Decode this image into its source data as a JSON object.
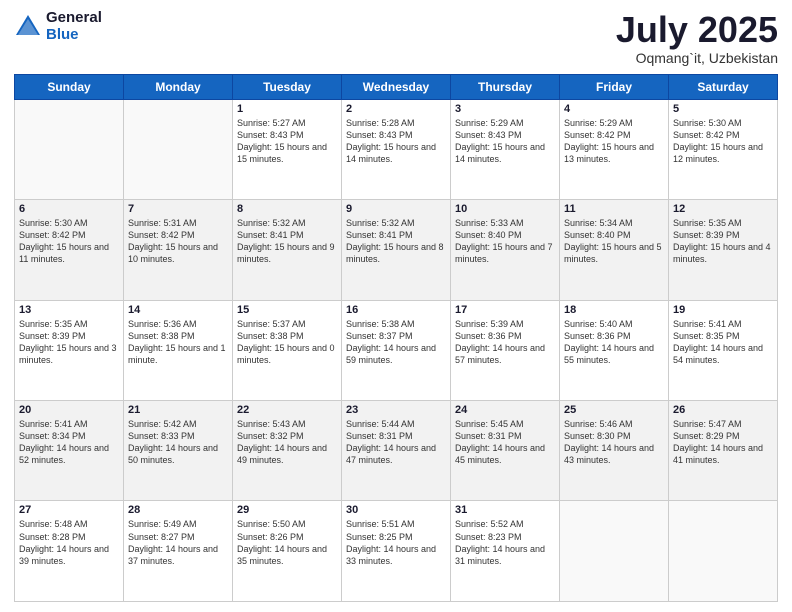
{
  "logo": {
    "general": "General",
    "blue": "Blue"
  },
  "title": {
    "month": "July 2025",
    "location": "Oqmang`it, Uzbekistan"
  },
  "weekdays": [
    "Sunday",
    "Monday",
    "Tuesday",
    "Wednesday",
    "Thursday",
    "Friday",
    "Saturday"
  ],
  "weeks": [
    [
      {
        "day": "",
        "sunrise": "",
        "sunset": "",
        "daylight": ""
      },
      {
        "day": "",
        "sunrise": "",
        "sunset": "",
        "daylight": ""
      },
      {
        "day": "1",
        "sunrise": "Sunrise: 5:27 AM",
        "sunset": "Sunset: 8:43 PM",
        "daylight": "Daylight: 15 hours and 15 minutes."
      },
      {
        "day": "2",
        "sunrise": "Sunrise: 5:28 AM",
        "sunset": "Sunset: 8:43 PM",
        "daylight": "Daylight: 15 hours and 14 minutes."
      },
      {
        "day": "3",
        "sunrise": "Sunrise: 5:29 AM",
        "sunset": "Sunset: 8:43 PM",
        "daylight": "Daylight: 15 hours and 14 minutes."
      },
      {
        "day": "4",
        "sunrise": "Sunrise: 5:29 AM",
        "sunset": "Sunset: 8:42 PM",
        "daylight": "Daylight: 15 hours and 13 minutes."
      },
      {
        "day": "5",
        "sunrise": "Sunrise: 5:30 AM",
        "sunset": "Sunset: 8:42 PM",
        "daylight": "Daylight: 15 hours and 12 minutes."
      }
    ],
    [
      {
        "day": "6",
        "sunrise": "Sunrise: 5:30 AM",
        "sunset": "Sunset: 8:42 PM",
        "daylight": "Daylight: 15 hours and 11 minutes."
      },
      {
        "day": "7",
        "sunrise": "Sunrise: 5:31 AM",
        "sunset": "Sunset: 8:42 PM",
        "daylight": "Daylight: 15 hours and 10 minutes."
      },
      {
        "day": "8",
        "sunrise": "Sunrise: 5:32 AM",
        "sunset": "Sunset: 8:41 PM",
        "daylight": "Daylight: 15 hours and 9 minutes."
      },
      {
        "day": "9",
        "sunrise": "Sunrise: 5:32 AM",
        "sunset": "Sunset: 8:41 PM",
        "daylight": "Daylight: 15 hours and 8 minutes."
      },
      {
        "day": "10",
        "sunrise": "Sunrise: 5:33 AM",
        "sunset": "Sunset: 8:40 PM",
        "daylight": "Daylight: 15 hours and 7 minutes."
      },
      {
        "day": "11",
        "sunrise": "Sunrise: 5:34 AM",
        "sunset": "Sunset: 8:40 PM",
        "daylight": "Daylight: 15 hours and 5 minutes."
      },
      {
        "day": "12",
        "sunrise": "Sunrise: 5:35 AM",
        "sunset": "Sunset: 8:39 PM",
        "daylight": "Daylight: 15 hours and 4 minutes."
      }
    ],
    [
      {
        "day": "13",
        "sunrise": "Sunrise: 5:35 AM",
        "sunset": "Sunset: 8:39 PM",
        "daylight": "Daylight: 15 hours and 3 minutes."
      },
      {
        "day": "14",
        "sunrise": "Sunrise: 5:36 AM",
        "sunset": "Sunset: 8:38 PM",
        "daylight": "Daylight: 15 hours and 1 minute."
      },
      {
        "day": "15",
        "sunrise": "Sunrise: 5:37 AM",
        "sunset": "Sunset: 8:38 PM",
        "daylight": "Daylight: 15 hours and 0 minutes."
      },
      {
        "day": "16",
        "sunrise": "Sunrise: 5:38 AM",
        "sunset": "Sunset: 8:37 PM",
        "daylight": "Daylight: 14 hours and 59 minutes."
      },
      {
        "day": "17",
        "sunrise": "Sunrise: 5:39 AM",
        "sunset": "Sunset: 8:36 PM",
        "daylight": "Daylight: 14 hours and 57 minutes."
      },
      {
        "day": "18",
        "sunrise": "Sunrise: 5:40 AM",
        "sunset": "Sunset: 8:36 PM",
        "daylight": "Daylight: 14 hours and 55 minutes."
      },
      {
        "day": "19",
        "sunrise": "Sunrise: 5:41 AM",
        "sunset": "Sunset: 8:35 PM",
        "daylight": "Daylight: 14 hours and 54 minutes."
      }
    ],
    [
      {
        "day": "20",
        "sunrise": "Sunrise: 5:41 AM",
        "sunset": "Sunset: 8:34 PM",
        "daylight": "Daylight: 14 hours and 52 minutes."
      },
      {
        "day": "21",
        "sunrise": "Sunrise: 5:42 AM",
        "sunset": "Sunset: 8:33 PM",
        "daylight": "Daylight: 14 hours and 50 minutes."
      },
      {
        "day": "22",
        "sunrise": "Sunrise: 5:43 AM",
        "sunset": "Sunset: 8:32 PM",
        "daylight": "Daylight: 14 hours and 49 minutes."
      },
      {
        "day": "23",
        "sunrise": "Sunrise: 5:44 AM",
        "sunset": "Sunset: 8:31 PM",
        "daylight": "Daylight: 14 hours and 47 minutes."
      },
      {
        "day": "24",
        "sunrise": "Sunrise: 5:45 AM",
        "sunset": "Sunset: 8:31 PM",
        "daylight": "Daylight: 14 hours and 45 minutes."
      },
      {
        "day": "25",
        "sunrise": "Sunrise: 5:46 AM",
        "sunset": "Sunset: 8:30 PM",
        "daylight": "Daylight: 14 hours and 43 minutes."
      },
      {
        "day": "26",
        "sunrise": "Sunrise: 5:47 AM",
        "sunset": "Sunset: 8:29 PM",
        "daylight": "Daylight: 14 hours and 41 minutes."
      }
    ],
    [
      {
        "day": "27",
        "sunrise": "Sunrise: 5:48 AM",
        "sunset": "Sunset: 8:28 PM",
        "daylight": "Daylight: 14 hours and 39 minutes."
      },
      {
        "day": "28",
        "sunrise": "Sunrise: 5:49 AM",
        "sunset": "Sunset: 8:27 PM",
        "daylight": "Daylight: 14 hours and 37 minutes."
      },
      {
        "day": "29",
        "sunrise": "Sunrise: 5:50 AM",
        "sunset": "Sunset: 8:26 PM",
        "daylight": "Daylight: 14 hours and 35 minutes."
      },
      {
        "day": "30",
        "sunrise": "Sunrise: 5:51 AM",
        "sunset": "Sunset: 8:25 PM",
        "daylight": "Daylight: 14 hours and 33 minutes."
      },
      {
        "day": "31",
        "sunrise": "Sunrise: 5:52 AM",
        "sunset": "Sunset: 8:23 PM",
        "daylight": "Daylight: 14 hours and 31 minutes."
      },
      {
        "day": "",
        "sunrise": "",
        "sunset": "",
        "daylight": ""
      },
      {
        "day": "",
        "sunrise": "",
        "sunset": "",
        "daylight": ""
      }
    ]
  ]
}
